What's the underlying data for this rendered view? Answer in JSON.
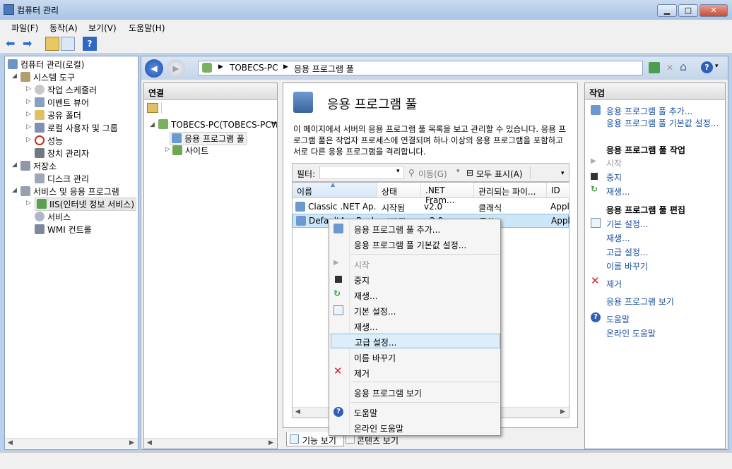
{
  "window": {
    "title": "컴퓨터 관리"
  },
  "menu": [
    "파일(F)",
    "동작(A)",
    "보기(V)",
    "도움말(H)"
  ],
  "tree": {
    "root": "컴퓨터 관리(로컬)",
    "items": [
      {
        "label": "시스템 도구"
      },
      {
        "label": "작업 스케줄러"
      },
      {
        "label": "이벤트 뷰어"
      },
      {
        "label": "공유 폴더"
      },
      {
        "label": "로컬 사용자 및 그룹"
      },
      {
        "label": "성능"
      },
      {
        "label": "장치 관리자"
      },
      {
        "label": "저장소"
      },
      {
        "label": "디스크 관리"
      },
      {
        "label": "서비스 및 응용 프로그램"
      },
      {
        "label": "IIS(인터넷 정보 서비스)"
      },
      {
        "label": "서비스"
      },
      {
        "label": "WMI 컨트롤"
      }
    ]
  },
  "address": {
    "crumbs": [
      "TOBECS-PC",
      "응용 프로그램 풀"
    ]
  },
  "connections": {
    "title": "연결",
    "server": "TOBECS-PC(TOBECS-PC₩T",
    "pools": "응용 프로그램 풀",
    "sites": "사이트"
  },
  "center": {
    "title": "응용 프로그램 풀",
    "description": "이 페이지에서 서버의 응용 프로그램 풀 목록을 보고 관리할 수 있습니다. 응용 프로그램 풀은 작업자 프로세스에 연결되며 하나 이상의 응용 프로그램을 포함하고 서로 다른 응용 프로그램을 격리합니다.",
    "filter_label": "필터:",
    "go_label": "이동(G)",
    "show_all_label": "모두 표시(A)",
    "columns": [
      "이름",
      "상태",
      ".NET Fram...",
      "관리되는 파이...",
      "ID"
    ],
    "rows": [
      [
        "Classic .NET Ap...",
        "시작됨",
        "v2.0",
        "클래식",
        "Appli"
      ],
      [
        "DefaultAppPool",
        "시작됨",
        "v2.0",
        "통합",
        "Appli"
      ]
    ],
    "view_tabs": [
      "기능 보기",
      "콘텐츠 보기"
    ]
  },
  "actions": {
    "title": "작업",
    "add": "응용 프로그램 풀 추가...",
    "defaults": "응용 프로그램 풀 기본값 설정...",
    "task_header": "응용 프로그램 풀 작업",
    "start": "시작",
    "stop": "중지",
    "recycle": "재생...",
    "edit_header": "응용 프로그램 풀 편집",
    "basic": "기본 설정...",
    "recycling": "재생...",
    "advanced": "고급 설정...",
    "rename": "이름 바꾸기",
    "remove": "제거",
    "view_apps": "응용 프로그램 보기",
    "help": "도움말",
    "online_help": "온라인 도움말"
  },
  "context_menu": {
    "items": [
      "응용 프로그램 풀 추가...",
      "응용 프로그램 풀 기본값 설정...",
      "시작",
      "중지",
      "재생...",
      "기본 설정...",
      "재생...",
      "고급 설정...",
      "이름 바꾸기",
      "제거",
      "응용 프로그램 보기",
      "도움말",
      "온라인 도움말"
    ],
    "highlighted": "고급 설정..."
  },
  "colors": {
    "link": "#1a4fa0",
    "highlight": "#cde6f7",
    "titlebar": "#b9d1ea"
  }
}
